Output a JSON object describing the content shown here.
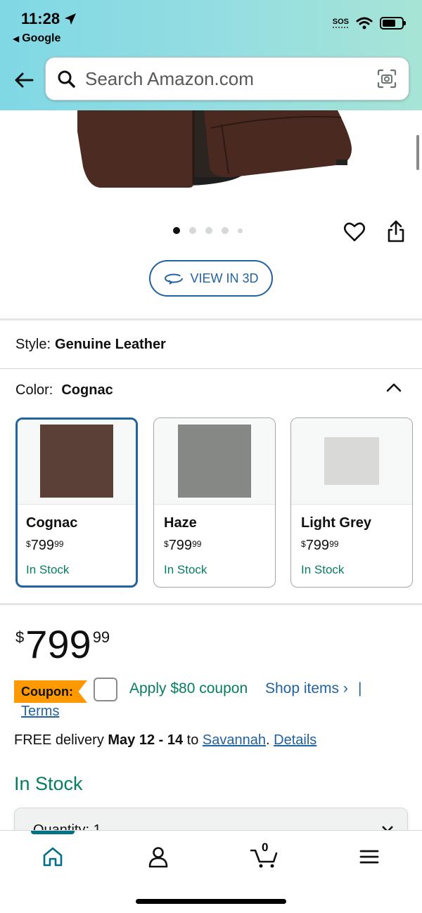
{
  "status_bar": {
    "time": "11:28",
    "back_app": "Google",
    "sos": "SOS"
  },
  "search": {
    "placeholder": "Search Amazon.com"
  },
  "gallery": {
    "view_3d_label": "VIEW IN 3D",
    "image_count": 5,
    "active_index": 0
  },
  "style": {
    "label": "Style:",
    "value": "Genuine Leather"
  },
  "color": {
    "label": "Color:",
    "value": "Cognac",
    "options": [
      {
        "name": "Cognac",
        "currency": "$",
        "whole": "799",
        "fraction": "99",
        "stock": "In Stock",
        "swatch": "#5a4037",
        "selected": true
      },
      {
        "name": "Haze",
        "currency": "$",
        "whole": "799",
        "fraction": "99",
        "stock": "In Stock",
        "swatch": "#868886",
        "selected": false
      },
      {
        "name": "Light Grey",
        "currency": "$",
        "whole": "799",
        "fraction": "99",
        "stock": "In Stock",
        "swatch": "#d9d9d7",
        "selected": false
      }
    ]
  },
  "price": {
    "currency": "$",
    "whole": "799",
    "fraction": "99"
  },
  "coupon": {
    "badge": "Coupon:",
    "apply_text": "Apply $80 coupon",
    "shop_items": "Shop items ›",
    "pipe": "|",
    "terms": "Terms"
  },
  "delivery": {
    "prefix": "FREE delivery",
    "dates": "May 12 - 14",
    "to": "to",
    "location": "Savannah",
    "period": ".",
    "details": "Details"
  },
  "availability": "In Stock",
  "quantity": {
    "label": "Quantity: 1"
  },
  "bottom_nav": {
    "cart_count": "0"
  },
  "colors": {
    "link": "#2162a1",
    "in_stock": "#067d62",
    "coupon_badge": "#ff9900",
    "nav_accent": "#007185"
  }
}
